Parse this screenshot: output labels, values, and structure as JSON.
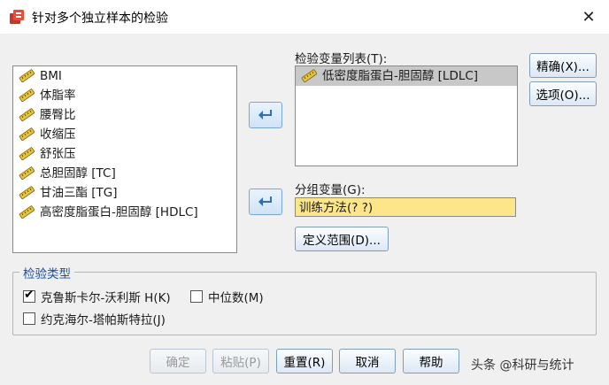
{
  "window": {
    "title": "针对多个独立样本的检验",
    "close_glyph": "✕"
  },
  "source_list": {
    "items": [
      {
        "label": "BMI"
      },
      {
        "label": "体脂率"
      },
      {
        "label": "腰臀比"
      },
      {
        "label": "收缩压"
      },
      {
        "label": "舒张压"
      },
      {
        "label": "总胆固醇 [TC]"
      },
      {
        "label": "甘油三酯 [TG]"
      },
      {
        "label": "高密度脂蛋白-胆固醇 [HDLC]"
      }
    ]
  },
  "test_variables": {
    "label": "检验变量列表(T):",
    "items": [
      {
        "label": "低密度脂蛋白-胆固醇 [LDLC]"
      }
    ]
  },
  "grouping": {
    "label": "分组变量(G):",
    "value": "训练方法(? ?)",
    "define_range_label": "定义范围(D)..."
  },
  "side_buttons": {
    "exact": "精确(X)...",
    "options": "选项(O)..."
  },
  "test_type": {
    "title": "检验类型",
    "kruskal": {
      "label": "克鲁斯卡尔-沃利斯 H(K)",
      "checked": true
    },
    "median": {
      "label": "中位数(M)",
      "checked": false
    },
    "jonckheere": {
      "label": "约克海尔-塔帕斯特拉(J)",
      "checked": false
    }
  },
  "footer": {
    "ok": "确定",
    "paste": "粘贴(P)",
    "reset": "重置(R)",
    "cancel": "取消",
    "help": "帮助"
  },
  "watermark": "头条 @科研与统计",
  "icons": {
    "variable": "ruler-scale-icon",
    "arrow": "move-arrow-icon",
    "app": "spss-dialog-icon"
  },
  "colors": {
    "accent": "#1a4fa0",
    "group_var_bg": "#fde68a",
    "selected_bg": "#c8c8c8"
  }
}
